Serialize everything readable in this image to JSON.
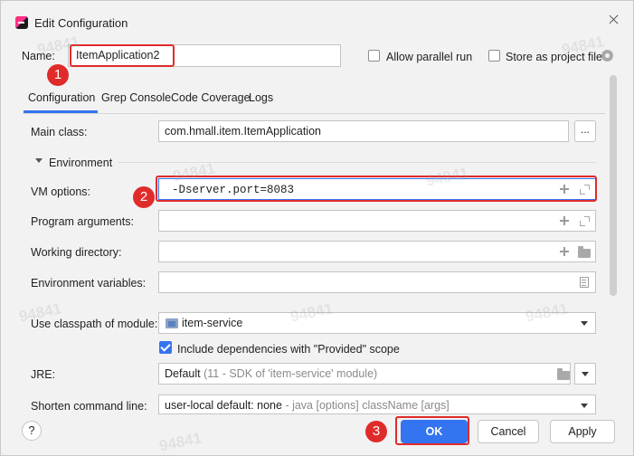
{
  "window": {
    "title": "Edit Configuration"
  },
  "name_row": {
    "label": "Name:",
    "value": "ItemApplication2",
    "allow_parallel_label": "Allow parallel run",
    "store_project_label": "Store as project file"
  },
  "tabs": [
    {
      "label": "Configuration"
    },
    {
      "label": "Grep Console"
    },
    {
      "label": "Code Coverage"
    },
    {
      "label": "Logs"
    }
  ],
  "form": {
    "main_class_label": "Main class:",
    "main_class_value": "com.hmall.item.ItemApplication",
    "browse_label": "...",
    "environment_label": "Environment",
    "vm_options_label": "VM options:",
    "vm_options_value": "-Dserver.port=8083",
    "program_args_label": "Program arguments:",
    "working_dir_label": "Working directory:",
    "env_vars_label": "Environment variables:",
    "classpath_label": "Use classpath of module:",
    "classpath_value": "item-service",
    "include_deps_label": "Include dependencies with \"Provided\" scope",
    "jre_label": "JRE:",
    "jre_value": "Default",
    "jre_detail": "(11 - SDK of 'item-service' module)",
    "shorten_label": "Shorten command line:",
    "shorten_value": "user-local default: none",
    "shorten_detail": "- java [options] className [args]"
  },
  "footer": {
    "help_label": "?",
    "ok_label": "OK",
    "cancel_label": "Cancel",
    "apply_label": "Apply"
  },
  "annotations": {
    "step1": "1",
    "step2": "2",
    "step3": "3"
  },
  "watermarks": [
    "94841",
    "94841",
    "94841",
    "94841",
    "94841",
    "94841",
    "94841",
    "94841"
  ],
  "colors": {
    "accent": "#3574f0",
    "highlight": "#e02b2b",
    "background": "#f2f2f2"
  }
}
